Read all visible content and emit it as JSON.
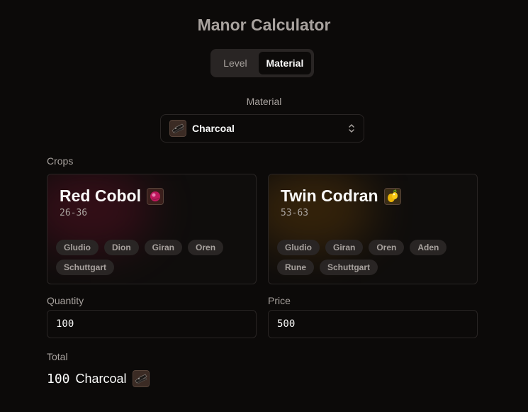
{
  "title": "Manor Calculator",
  "mode_toggle": {
    "options": [
      "Level",
      "Material"
    ],
    "selected": "Material"
  },
  "material": {
    "label": "Material",
    "selected": "Charcoal",
    "icon": "charcoal-icon"
  },
  "crops": {
    "label": "Crops",
    "items": [
      {
        "name": "Red Cobol",
        "icon": "red-cobol-icon",
        "range": "26-36",
        "castles": [
          "Gludio",
          "Dion",
          "Giran",
          "Oren",
          "Schuttgart"
        ],
        "accent": "#b91c4a"
      },
      {
        "name": "Twin Codran",
        "icon": "twin-codran-icon",
        "range": "53-63",
        "castles": [
          "Gludio",
          "Giran",
          "Oren",
          "Aden",
          "Rune",
          "Schuttgart"
        ],
        "accent": "#ca8a04"
      }
    ]
  },
  "quantity": {
    "label": "Quantity",
    "value": "100"
  },
  "price": {
    "label": "Price",
    "value": "500"
  },
  "total": {
    "label": "Total",
    "amount": "100",
    "item": "Charcoal",
    "icon": "charcoal-icon"
  },
  "colors": {
    "background": "#0c0a09",
    "border": "#292524",
    "muted_text": "#a8a29e",
    "text": "#fafaf9"
  }
}
